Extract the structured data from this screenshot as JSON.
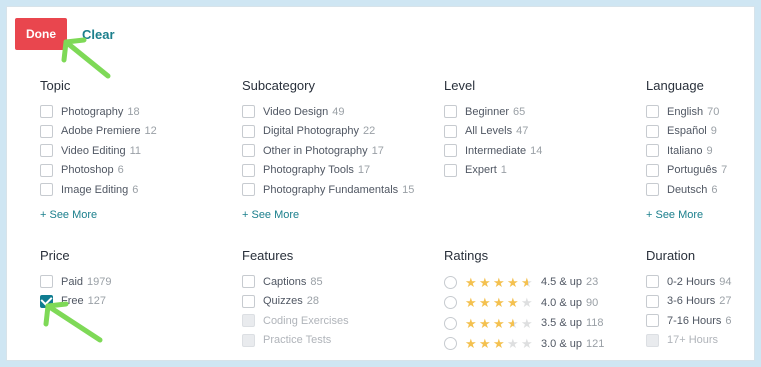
{
  "toolbar": {
    "done_label": "Done",
    "clear_label": "Clear"
  },
  "groups": {
    "topic": {
      "title": "Topic",
      "options": [
        {
          "label": "Photography",
          "count": "18"
        },
        {
          "label": "Adobe Premiere",
          "count": "12"
        },
        {
          "label": "Video Editing",
          "count": "11"
        },
        {
          "label": "Photoshop",
          "count": "6"
        },
        {
          "label": "Image Editing",
          "count": "6"
        }
      ],
      "see_more": "+ See More"
    },
    "subcategory": {
      "title": "Subcategory",
      "options": [
        {
          "label": "Video Design",
          "count": "49"
        },
        {
          "label": "Digital Photography",
          "count": "22"
        },
        {
          "label": "Other in Photography",
          "count": "17"
        },
        {
          "label": "Photography Tools",
          "count": "17"
        },
        {
          "label": "Photography Fundamentals",
          "count": "15"
        }
      ],
      "see_more": "+ See More"
    },
    "level": {
      "title": "Level",
      "options": [
        {
          "label": "Beginner",
          "count": "65"
        },
        {
          "label": "All Levels",
          "count": "47"
        },
        {
          "label": "Intermediate",
          "count": "14"
        },
        {
          "label": "Expert",
          "count": "1"
        }
      ]
    },
    "language": {
      "title": "Language",
      "options": [
        {
          "label": "English",
          "count": "70"
        },
        {
          "label": "Español",
          "count": "9"
        },
        {
          "label": "Italiano",
          "count": "9"
        },
        {
          "label": "Português",
          "count": "7"
        },
        {
          "label": "Deutsch",
          "count": "6"
        }
      ],
      "see_more": "+ See More"
    },
    "price": {
      "title": "Price",
      "options": [
        {
          "label": "Paid",
          "count": "1979",
          "checked": false
        },
        {
          "label": "Free",
          "count": "127",
          "checked": true
        }
      ]
    },
    "features": {
      "title": "Features",
      "options": [
        {
          "label": "Captions",
          "count": "85",
          "disabled": false
        },
        {
          "label": "Quizzes",
          "count": "28",
          "disabled": false
        },
        {
          "label": "Coding Exercises",
          "count": "",
          "disabled": true
        },
        {
          "label": "Practice Tests",
          "count": "",
          "disabled": true
        }
      ]
    },
    "ratings": {
      "title": "Ratings",
      "options": [
        {
          "stars": 4.5,
          "label": "4.5 & up",
          "count": "23"
        },
        {
          "stars": 4.0,
          "label": "4.0 & up",
          "count": "90"
        },
        {
          "stars": 3.5,
          "label": "3.5 & up",
          "count": "118"
        },
        {
          "stars": 3.0,
          "label": "3.0 & up",
          "count": "121"
        }
      ]
    },
    "duration": {
      "title": "Duration",
      "options": [
        {
          "label": "0-2 Hours",
          "count": "94",
          "disabled": false
        },
        {
          "label": "3-6 Hours",
          "count": "27",
          "disabled": false
        },
        {
          "label": "7-16 Hours",
          "count": "6",
          "disabled": false
        },
        {
          "label": "17+ Hours",
          "count": "",
          "disabled": true
        }
      ]
    }
  },
  "colors": {
    "done_button": "#e9464e",
    "link": "#1b7f8c",
    "star": "#f4c150",
    "checkbox_checked": "#0f7c90",
    "annotation_arrow": "#7ed957"
  },
  "icons": {
    "star": "star-icon",
    "check": "check-icon",
    "arrow": "arrow-annotation-icon"
  }
}
